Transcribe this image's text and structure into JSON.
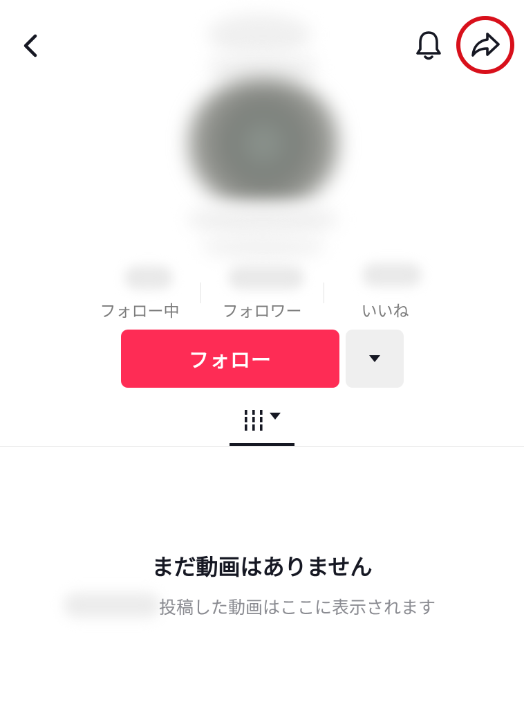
{
  "header": {
    "back_icon": "chevron-left-icon",
    "bell_icon": "bell-icon",
    "share_icon": "share-arrow-icon",
    "share_highlight_color": "#d8101b"
  },
  "stats": {
    "following_label": "フォロー中",
    "followers_label": "フォロワー",
    "likes_label": "いいね"
  },
  "actions": {
    "follow_label": "フォロー",
    "follow_color": "#fe2c55",
    "more_icon": "caret-down-icon"
  },
  "tabs": {
    "videos_icon": "grid-columns-icon",
    "dropdown_icon": "caret-down-icon"
  },
  "empty_state": {
    "title": "まだ動画はありません",
    "subtitle": "投稿した動画はここに表示されます"
  }
}
